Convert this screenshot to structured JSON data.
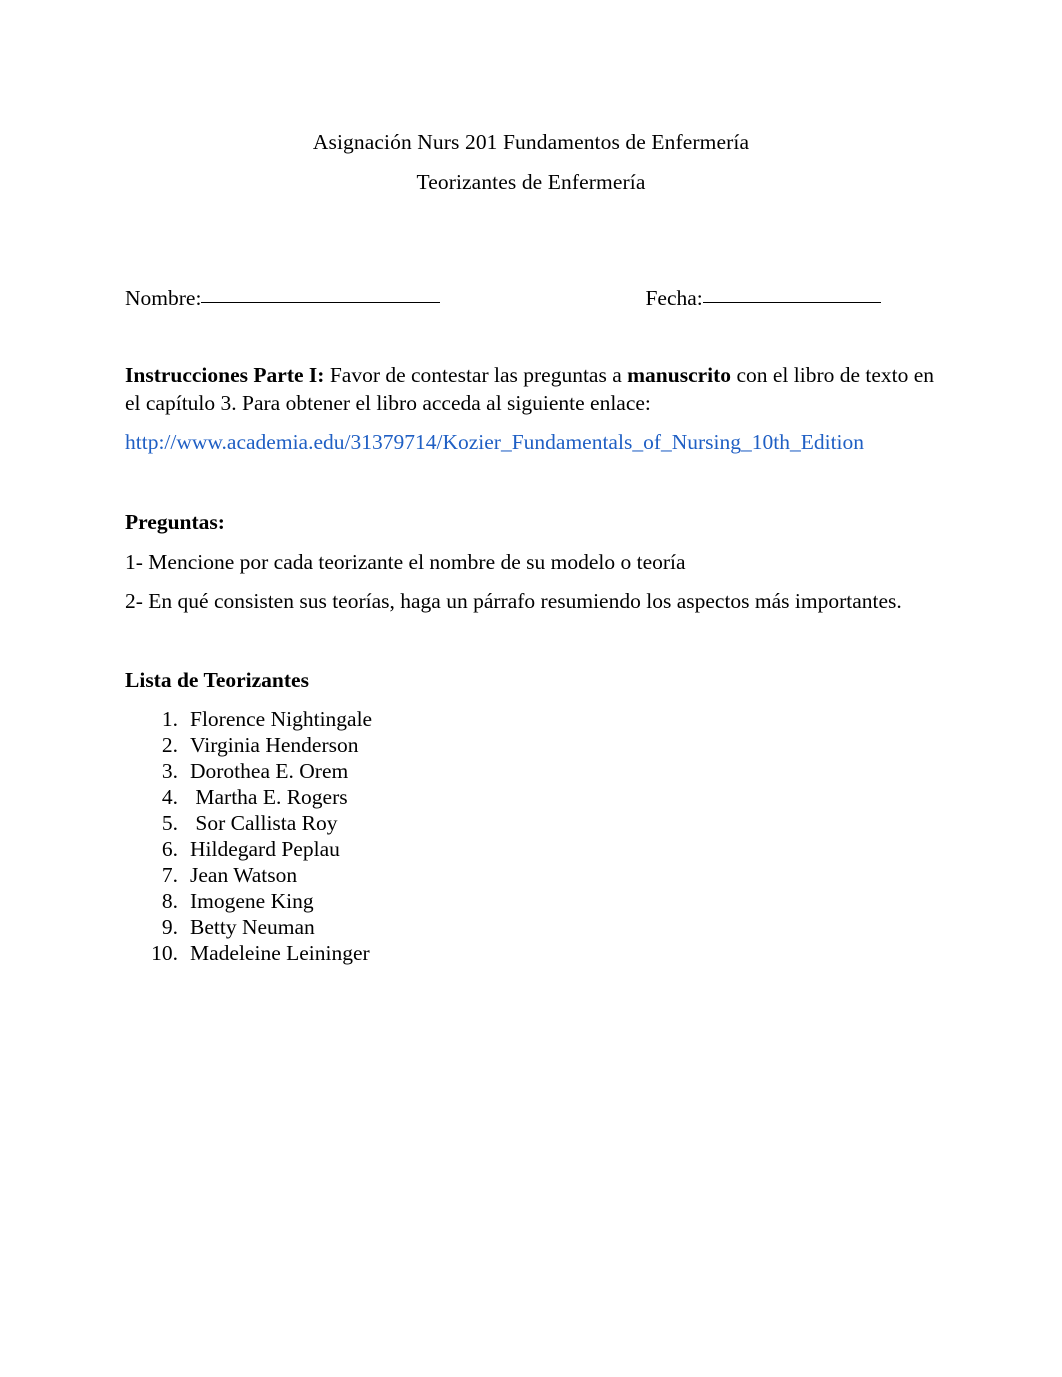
{
  "document": {
    "title_lines": [
      "Asignación Nurs 201 Fundamentos de Enfermería",
      "Teorizantes de Enfermería"
    ],
    "fields": {
      "nombre_label": "Nombre:",
      "nombre_value": "",
      "fecha_label": "Fecha:",
      "fecha_value": ""
    },
    "instructions": {
      "heading": "Instrucciones Parte I:",
      "text_before_bold": " Favor de contestar las preguntas a ",
      "bold_word": "manuscrito",
      "text_after_bold": " con el libro de texto en el capítulo 3. Para obtener el libro acceda al siguiente enlace:"
    },
    "link": {
      "text": "http://www.academia.edu/31379714/Kozier_Fundamentals_of_Nursing_10th_Edition",
      "color": "#1F5FC4"
    },
    "questions": {
      "heading": "Preguntas:",
      "items": [
        "1- Mencione por cada teorizante el nombre de su modelo o teoría",
        "2- En qué consisten sus teorías, haga un párrafo resumiendo los aspectos más importantes."
      ]
    },
    "list_section": {
      "heading": "Lista de Teorizantes",
      "items": [
        {
          "number": "1.",
          "name": "Florence Nightingale"
        },
        {
          "number": "2.",
          "name": "Virginia Henderson"
        },
        {
          "number": "3.",
          "name": "Dorothea E. Orem"
        },
        {
          "number": "4.",
          "name": " Martha E. Rogers"
        },
        {
          "number": "5.",
          "name": " Sor Callista Roy"
        },
        {
          "number": "6.",
          "name": "Hildegard Peplau"
        },
        {
          "number": "7.",
          "name": "Jean Watson"
        },
        {
          "number": "8.",
          "name": "Imogene King"
        },
        {
          "number": "9.",
          "name": "Betty Neuman"
        },
        {
          "number": "10.",
          "name": "Madeleine Leininger"
        }
      ]
    }
  }
}
